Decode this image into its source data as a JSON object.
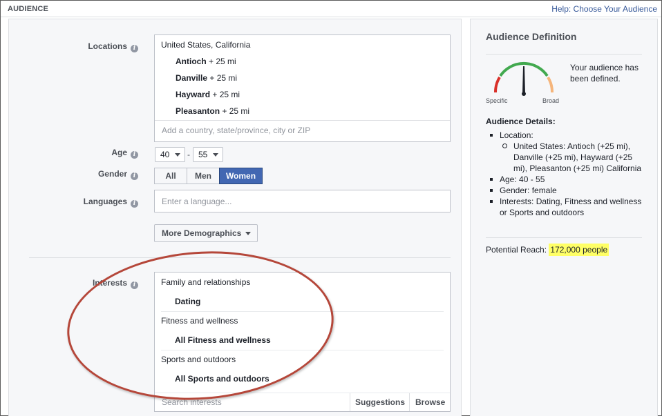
{
  "header": {
    "title": "AUDIENCE",
    "help_link": "Help: Choose Your Audience"
  },
  "form": {
    "locations": {
      "label": "Locations",
      "country": "United States, California",
      "cities": [
        {
          "name": "Antioch",
          "radius": "+ 25 mi"
        },
        {
          "name": "Danville",
          "radius": "+ 25 mi"
        },
        {
          "name": "Hayward",
          "radius": "+ 25 mi"
        },
        {
          "name": "Pleasanton",
          "radius": "+ 25 mi"
        }
      ],
      "placeholder": "Add a country, state/province, city or ZIP"
    },
    "age": {
      "label": "Age",
      "min": "40",
      "max": "55",
      "separator": "-"
    },
    "gender": {
      "label": "Gender",
      "options": [
        "All",
        "Men",
        "Women"
      ],
      "selected": "Women"
    },
    "languages": {
      "label": "Languages",
      "placeholder": "Enter a language..."
    },
    "more_demographics": "More Demographics",
    "interests": {
      "label": "Interests",
      "groups": [
        {
          "category": "Family and relationships",
          "item": "Dating"
        },
        {
          "category": "Fitness and wellness",
          "item": "All Fitness and wellness"
        },
        {
          "category": "Sports and outdoors",
          "item": "All Sports and outdoors"
        }
      ],
      "search_placeholder": "Search interests",
      "suggestions": "Suggestions",
      "browse": "Browse"
    },
    "info_glyph": "i"
  },
  "definition": {
    "title": "Audience Definition",
    "gauge_specific": "Specific",
    "gauge_broad": "Broad",
    "status": "Your audience has been defined.",
    "details_title": "Audience Details:",
    "location_label": "Location:",
    "location_value": "United States: Antioch (+25 mi), Danville (+25 mi), Hayward (+25 mi), Pleasanton (+25 mi) California",
    "age": "Age: 40 - 55",
    "gender": "Gender: female",
    "interests": "Interests: Dating, Fitness and wellness or Sports and outdoors",
    "reach_label": "Potential Reach:",
    "reach_value": "172,000 people"
  },
  "colors": {
    "accent": "#4267b2",
    "annotation_circle": "#b5473a",
    "highlight": "#ffff66",
    "gauge_red": "#d9312a",
    "gauge_green": "#42a94f",
    "gauge_orange": "#f5b57b"
  }
}
